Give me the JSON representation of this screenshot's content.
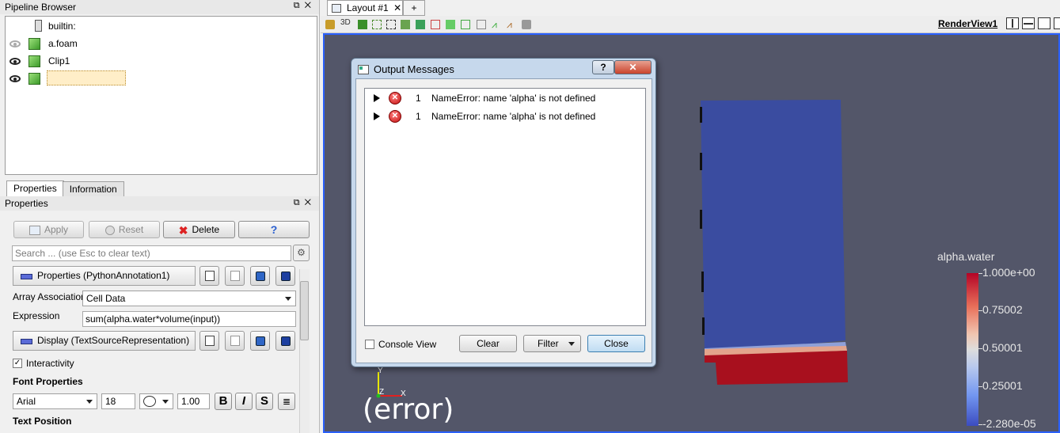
{
  "pipeline_browser": {
    "title": "Pipeline Browser",
    "items": [
      {
        "label": "builtin:"
      },
      {
        "label": "a.foam"
      },
      {
        "label": "Clip1"
      },
      {
        "label": ""
      }
    ]
  },
  "prop_tabs": {
    "properties": "Properties",
    "information": "Information"
  },
  "properties_panel": {
    "title": "Properties",
    "apply": "Apply",
    "reset": "Reset",
    "delete": "Delete",
    "help": "?",
    "search_placeholder": "Search ... (use Esc to clear text)",
    "section1": "Properties (PythonAnnotation1)",
    "array_assoc_label": "Array Association",
    "array_assoc_value": "Cell Data",
    "expression_label": "Expression",
    "expression_value": "sum(alpha.water*volume(input))",
    "section2": "Display (TextSourceRepresentation)",
    "interactivity": "Interactivity",
    "font_properties": "Font Properties",
    "font_family": "Arial",
    "font_size": "18",
    "opacity": "1.00",
    "bold": "B",
    "italic": "I",
    "shadow": "S",
    "text_position": "Text Position"
  },
  "layout_tab": {
    "label": "Layout #1",
    "close": "✕",
    "add": "+"
  },
  "toolbar": {
    "mode_3d": "3D",
    "render_view": "RenderView1"
  },
  "view": {
    "error_text": "(error)",
    "axes": {
      "y": "Y",
      "z": "Z",
      "x": "X"
    }
  },
  "legend": {
    "title": "alpha.water",
    "labels": [
      "1.000e+00",
      "0.75002",
      "0.50001",
      "0.25001",
      "-2.280e-05"
    ],
    "colors": {
      "high": "#b40426",
      "mid": "#dddddd",
      "low": "#3b4cc0"
    }
  },
  "output_dialog": {
    "title": "Output Messages",
    "help": "?",
    "close_x": "✕",
    "messages": [
      {
        "count": "1",
        "text": "NameError: name 'alpha' is not defined"
      },
      {
        "count": "1",
        "text": "NameError: name 'alpha' is not defined"
      }
    ],
    "console_view": "Console View",
    "clear": "Clear",
    "filter": "Filter",
    "close": "Close"
  }
}
